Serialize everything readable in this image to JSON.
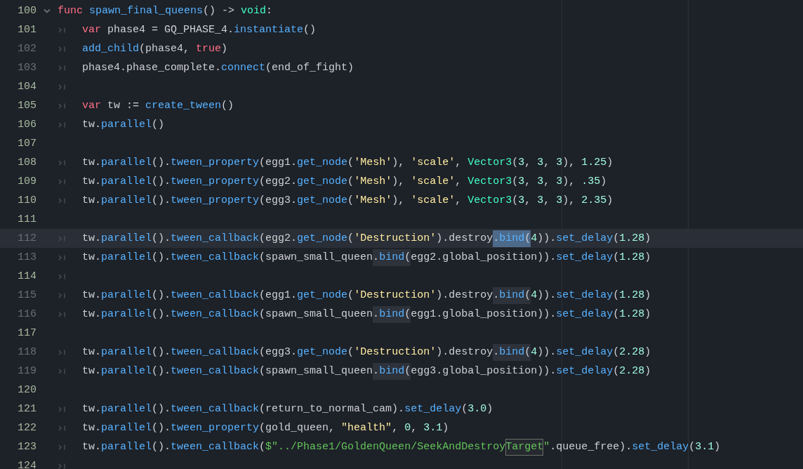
{
  "editor": {
    "lines": [
      {
        "number": "100",
        "changed": true,
        "current": false,
        "foldable": true,
        "expanded": true,
        "indented": false,
        "tokens": [
          {
            "text": "func ",
            "kind": "keyword"
          },
          {
            "text": "spawn_final_queens",
            "kind": "function"
          },
          {
            "text": "() -> ",
            "kind": "plain"
          },
          {
            "text": "void",
            "kind": "type"
          },
          {
            "text": ":",
            "kind": "plain"
          }
        ]
      },
      {
        "number": "101",
        "changed": true,
        "current": false,
        "indented": true,
        "tokens": [
          {
            "text": "var",
            "kind": "keyword"
          },
          {
            "text": " phase4 = GQ_PHASE_4.",
            "kind": "plain"
          },
          {
            "text": "instantiate",
            "kind": "function"
          },
          {
            "text": "()",
            "kind": "plain"
          }
        ]
      },
      {
        "number": "102",
        "changed": false,
        "current": false,
        "indented": true,
        "tokens": [
          {
            "text": "add_child",
            "kind": "function"
          },
          {
            "text": "(phase4, ",
            "kind": "plain"
          },
          {
            "text": "true",
            "kind": "keyword"
          },
          {
            "text": ")",
            "kind": "plain"
          }
        ]
      },
      {
        "number": "103",
        "changed": false,
        "current": false,
        "indented": true,
        "tokens": [
          {
            "text": "phase4.phase_complete.",
            "kind": "plain"
          },
          {
            "text": "connect",
            "kind": "function"
          },
          {
            "text": "(end_of_fight)",
            "kind": "plain"
          }
        ]
      },
      {
        "number": "104",
        "changed": true,
        "current": false,
        "indented": true
      },
      {
        "number": "105",
        "changed": true,
        "current": false,
        "indented": true,
        "tokens": [
          {
            "text": "var",
            "kind": "keyword"
          },
          {
            "text": " tw := ",
            "kind": "plain"
          },
          {
            "text": "create_tween",
            "kind": "function"
          },
          {
            "text": "()",
            "kind": "plain"
          }
        ]
      },
      {
        "number": "106",
        "changed": true,
        "current": false,
        "indented": true,
        "tokens": [
          {
            "text": "tw.",
            "kind": "plain"
          },
          {
            "text": "parallel",
            "kind": "function"
          },
          {
            "text": "()",
            "kind": "plain"
          }
        ]
      },
      {
        "number": "107",
        "changed": true,
        "current": false,
        "indented": false
      },
      {
        "number": "108",
        "changed": true,
        "current": false,
        "indented": true,
        "tokens": [
          {
            "text": "tw.",
            "kind": "plain"
          },
          {
            "text": "parallel",
            "kind": "function"
          },
          {
            "text": "().",
            "kind": "plain"
          },
          {
            "text": "tween_property",
            "kind": "function"
          },
          {
            "text": "(egg1.",
            "kind": "plain"
          },
          {
            "text": "get_node",
            "kind": "function"
          },
          {
            "text": "(",
            "kind": "plain"
          },
          {
            "text": "'Mesh'",
            "kind": "string"
          },
          {
            "text": "), ",
            "kind": "plain"
          },
          {
            "text": "'scale'",
            "kind": "string"
          },
          {
            "text": ", ",
            "kind": "plain"
          },
          {
            "text": "Vector3",
            "kind": "type"
          },
          {
            "text": "(",
            "kind": "plain"
          },
          {
            "text": "3",
            "kind": "number"
          },
          {
            "text": ", ",
            "kind": "plain"
          },
          {
            "text": "3",
            "kind": "number"
          },
          {
            "text": ", ",
            "kind": "plain"
          },
          {
            "text": "3",
            "kind": "number"
          },
          {
            "text": "), ",
            "kind": "plain"
          },
          {
            "text": "1.25",
            "kind": "number"
          },
          {
            "text": ")",
            "kind": "plain"
          }
        ]
      },
      {
        "number": "109",
        "changed": true,
        "current": false,
        "indented": true,
        "tokens": [
          {
            "text": "tw.",
            "kind": "plain"
          },
          {
            "text": "parallel",
            "kind": "function"
          },
          {
            "text": "().",
            "kind": "plain"
          },
          {
            "text": "tween_property",
            "kind": "function"
          },
          {
            "text": "(egg2.",
            "kind": "plain"
          },
          {
            "text": "get_node",
            "kind": "function"
          },
          {
            "text": "(",
            "kind": "plain"
          },
          {
            "text": "'Mesh'",
            "kind": "string"
          },
          {
            "text": "), ",
            "kind": "plain"
          },
          {
            "text": "'scale'",
            "kind": "string"
          },
          {
            "text": ", ",
            "kind": "plain"
          },
          {
            "text": "Vector3",
            "kind": "type"
          },
          {
            "text": "(",
            "kind": "plain"
          },
          {
            "text": "3",
            "kind": "number"
          },
          {
            "text": ", ",
            "kind": "plain"
          },
          {
            "text": "3",
            "kind": "number"
          },
          {
            "text": ", ",
            "kind": "plain"
          },
          {
            "text": "3",
            "kind": "number"
          },
          {
            "text": "), ",
            "kind": "plain"
          },
          {
            "text": ".35",
            "kind": "number"
          },
          {
            "text": ")",
            "kind": "plain"
          }
        ]
      },
      {
        "number": "110",
        "changed": true,
        "current": false,
        "indented": true,
        "tokens": [
          {
            "text": "tw.",
            "kind": "plain"
          },
          {
            "text": "parallel",
            "kind": "function"
          },
          {
            "text": "().",
            "kind": "plain"
          },
          {
            "text": "tween_property",
            "kind": "function"
          },
          {
            "text": "(egg3.",
            "kind": "plain"
          },
          {
            "text": "get_node",
            "kind": "function"
          },
          {
            "text": "(",
            "kind": "plain"
          },
          {
            "text": "'Mesh'",
            "kind": "string"
          },
          {
            "text": "), ",
            "kind": "plain"
          },
          {
            "text": "'scale'",
            "kind": "string"
          },
          {
            "text": ", ",
            "kind": "plain"
          },
          {
            "text": "Vector3",
            "kind": "type"
          },
          {
            "text": "(",
            "kind": "plain"
          },
          {
            "text": "3",
            "kind": "number"
          },
          {
            "text": ", ",
            "kind": "plain"
          },
          {
            "text": "3",
            "kind": "number"
          },
          {
            "text": ", ",
            "kind": "plain"
          },
          {
            "text": "3",
            "kind": "number"
          },
          {
            "text": "), ",
            "kind": "plain"
          },
          {
            "text": "2.35",
            "kind": "number"
          },
          {
            "text": ")",
            "kind": "plain"
          }
        ]
      },
      {
        "number": "111",
        "changed": true,
        "current": false,
        "indented": false
      },
      {
        "number": "112",
        "changed": false,
        "current": true,
        "indented": true,
        "tokens": [
          {
            "text": "tw.",
            "kind": "plain"
          },
          {
            "text": "parallel",
            "kind": "function"
          },
          {
            "text": "().",
            "kind": "plain"
          },
          {
            "text": "tween_callback",
            "kind": "function"
          },
          {
            "text": "(egg2.",
            "kind": "plain"
          },
          {
            "text": "get_node",
            "kind": "function"
          },
          {
            "text": "(",
            "kind": "plain"
          },
          {
            "text": "'Destruction'",
            "kind": "string"
          },
          {
            "text": ").destroy",
            "kind": "plain"
          },
          {
            "text": ".",
            "kind": "plain",
            "selected": true
          },
          {
            "text": "bind",
            "kind": "function",
            "selected": true
          },
          {
            "text": "(",
            "kind": "plain",
            "selected": true
          },
          {
            "text": "4",
            "kind": "number"
          },
          {
            "text": ")).",
            "kind": "plain"
          },
          {
            "text": "set_delay",
            "kind": "function"
          },
          {
            "text": "(",
            "kind": "plain"
          },
          {
            "text": "1.28",
            "kind": "number"
          },
          {
            "text": ")",
            "kind": "plain"
          }
        ]
      },
      {
        "number": "113",
        "changed": false,
        "current": false,
        "indented": true,
        "tokens": [
          {
            "text": "tw.",
            "kind": "plain"
          },
          {
            "text": "parallel",
            "kind": "function"
          },
          {
            "text": "().",
            "kind": "plain"
          },
          {
            "text": "tween_callback",
            "kind": "function"
          },
          {
            "text": "(spawn_small_queen",
            "kind": "plain"
          },
          {
            "text": ".",
            "kind": "plain",
            "occurrence": true
          },
          {
            "text": "bind",
            "kind": "function",
            "occurrence": true
          },
          {
            "text": "(",
            "kind": "plain",
            "occurrence": true
          },
          {
            "text": "egg2.global_position)).",
            "kind": "plain"
          },
          {
            "text": "set_delay",
            "kind": "function"
          },
          {
            "text": "(",
            "kind": "plain"
          },
          {
            "text": "1.28",
            "kind": "number"
          },
          {
            "text": ")",
            "kind": "plain"
          }
        ]
      },
      {
        "number": "114",
        "changed": true,
        "current": false,
        "indented": true
      },
      {
        "number": "115",
        "changed": false,
        "current": false,
        "indented": true,
        "tokens": [
          {
            "text": "tw.",
            "kind": "plain"
          },
          {
            "text": "parallel",
            "kind": "function"
          },
          {
            "text": "().",
            "kind": "plain"
          },
          {
            "text": "tween_callback",
            "kind": "function"
          },
          {
            "text": "(egg1.",
            "kind": "plain"
          },
          {
            "text": "get_node",
            "kind": "function"
          },
          {
            "text": "(",
            "kind": "plain"
          },
          {
            "text": "'Destruction'",
            "kind": "string"
          },
          {
            "text": ").destroy",
            "kind": "plain"
          },
          {
            "text": ".",
            "kind": "plain",
            "occurrence": true
          },
          {
            "text": "bind",
            "kind": "function",
            "occurrence": true
          },
          {
            "text": "(",
            "kind": "plain",
            "occurrence": true
          },
          {
            "text": "4",
            "kind": "number"
          },
          {
            "text": ")).",
            "kind": "plain"
          },
          {
            "text": "set_delay",
            "kind": "function"
          },
          {
            "text": "(",
            "kind": "plain"
          },
          {
            "text": "1.28",
            "kind": "number"
          },
          {
            "text": ")",
            "kind": "plain"
          }
        ]
      },
      {
        "number": "116",
        "changed": false,
        "current": false,
        "indented": true,
        "tokens": [
          {
            "text": "tw.",
            "kind": "plain"
          },
          {
            "text": "parallel",
            "kind": "function"
          },
          {
            "text": "().",
            "kind": "plain"
          },
          {
            "text": "tween_callback",
            "kind": "function"
          },
          {
            "text": "(spawn_small_queen",
            "kind": "plain"
          },
          {
            "text": ".",
            "kind": "plain",
            "occurrence": true
          },
          {
            "text": "bind",
            "kind": "function",
            "occurrence": true
          },
          {
            "text": "(",
            "kind": "plain",
            "occurrence": true
          },
          {
            "text": "egg1.global_position)).",
            "kind": "plain"
          },
          {
            "text": "set_delay",
            "kind": "function"
          },
          {
            "text": "(",
            "kind": "plain"
          },
          {
            "text": "1.28",
            "kind": "number"
          },
          {
            "text": ")",
            "kind": "plain"
          }
        ]
      },
      {
        "number": "117",
        "changed": true,
        "current": false,
        "indented": false
      },
      {
        "number": "118",
        "changed": false,
        "current": false,
        "indented": true,
        "tokens": [
          {
            "text": "tw.",
            "kind": "plain"
          },
          {
            "text": "parallel",
            "kind": "function"
          },
          {
            "text": "().",
            "kind": "plain"
          },
          {
            "text": "tween_callback",
            "kind": "function"
          },
          {
            "text": "(egg3.",
            "kind": "plain"
          },
          {
            "text": "get_node",
            "kind": "function"
          },
          {
            "text": "(",
            "kind": "plain"
          },
          {
            "text": "'Destruction'",
            "kind": "string"
          },
          {
            "text": ").destroy",
            "kind": "plain"
          },
          {
            "text": ".",
            "kind": "plain",
            "occurrence": true
          },
          {
            "text": "bind",
            "kind": "function",
            "occurrence": true
          },
          {
            "text": "(",
            "kind": "plain",
            "occurrence": true
          },
          {
            "text": "4",
            "kind": "number"
          },
          {
            "text": ")).",
            "kind": "plain"
          },
          {
            "text": "set_delay",
            "kind": "function"
          },
          {
            "text": "(",
            "kind": "plain"
          },
          {
            "text": "2.28",
            "kind": "number"
          },
          {
            "text": ")",
            "kind": "plain"
          }
        ]
      },
      {
        "number": "119",
        "changed": false,
        "current": false,
        "indented": true,
        "tokens": [
          {
            "text": "tw.",
            "kind": "plain"
          },
          {
            "text": "parallel",
            "kind": "function"
          },
          {
            "text": "().",
            "kind": "plain"
          },
          {
            "text": "tween_callback",
            "kind": "function"
          },
          {
            "text": "(spawn_small_queen",
            "kind": "plain"
          },
          {
            "text": ".",
            "kind": "plain",
            "occurrence": true
          },
          {
            "text": "bind",
            "kind": "function",
            "occurrence": true
          },
          {
            "text": "(",
            "kind": "plain",
            "occurrence": true
          },
          {
            "text": "egg3.global_position)).",
            "kind": "plain"
          },
          {
            "text": "set_delay",
            "kind": "function"
          },
          {
            "text": "(",
            "kind": "plain"
          },
          {
            "text": "2.28",
            "kind": "number"
          },
          {
            "text": ")",
            "kind": "plain"
          }
        ]
      },
      {
        "number": "120",
        "changed": true,
        "current": false,
        "indented": false
      },
      {
        "number": "121",
        "changed": true,
        "current": false,
        "indented": true,
        "tokens": [
          {
            "text": "tw.",
            "kind": "plain"
          },
          {
            "text": "parallel",
            "kind": "function"
          },
          {
            "text": "().",
            "kind": "plain"
          },
          {
            "text": "tween_callback",
            "kind": "function"
          },
          {
            "text": "(return_to_normal_cam).",
            "kind": "plain"
          },
          {
            "text": "set_delay",
            "kind": "function"
          },
          {
            "text": "(",
            "kind": "plain"
          },
          {
            "text": "3.0",
            "kind": "number"
          },
          {
            "text": ")",
            "kind": "plain"
          }
        ]
      },
      {
        "number": "122",
        "changed": true,
        "current": false,
        "indented": true,
        "tokens": [
          {
            "text": "tw.",
            "kind": "plain"
          },
          {
            "text": "parallel",
            "kind": "function"
          },
          {
            "text": "().",
            "kind": "plain"
          },
          {
            "text": "tween_property",
            "kind": "function"
          },
          {
            "text": "(gold_queen, ",
            "kind": "plain"
          },
          {
            "text": "\"health\"",
            "kind": "string"
          },
          {
            "text": ", ",
            "kind": "plain"
          },
          {
            "text": "0",
            "kind": "number"
          },
          {
            "text": ", ",
            "kind": "plain"
          },
          {
            "text": "3.1",
            "kind": "number"
          },
          {
            "text": ")",
            "kind": "plain"
          }
        ]
      },
      {
        "number": "123",
        "changed": true,
        "current": false,
        "indented": true,
        "tokens": [
          {
            "text": "tw.",
            "kind": "plain"
          },
          {
            "text": "parallel",
            "kind": "function"
          },
          {
            "text": "().",
            "kind": "plain"
          },
          {
            "text": "tween_callback",
            "kind": "function"
          },
          {
            "text": "(",
            "kind": "plain"
          },
          {
            "text": "$\"../Phase1/GoldenQueen/SeekAndDestroy",
            "kind": "nodepath"
          },
          {
            "text": "Target",
            "kind": "nodepath",
            "search_match": true
          },
          {
            "text": "\"",
            "kind": "nodepath"
          },
          {
            "text": ".queue_free).",
            "kind": "plain"
          },
          {
            "text": "set_delay",
            "kind": "function"
          },
          {
            "text": "(",
            "kind": "plain"
          },
          {
            "text": "3.1",
            "kind": "number"
          },
          {
            "text": ")",
            "kind": "plain"
          }
        ]
      },
      {
        "number": "124",
        "changed": true,
        "current": false,
        "indented": true
      }
    ]
  }
}
